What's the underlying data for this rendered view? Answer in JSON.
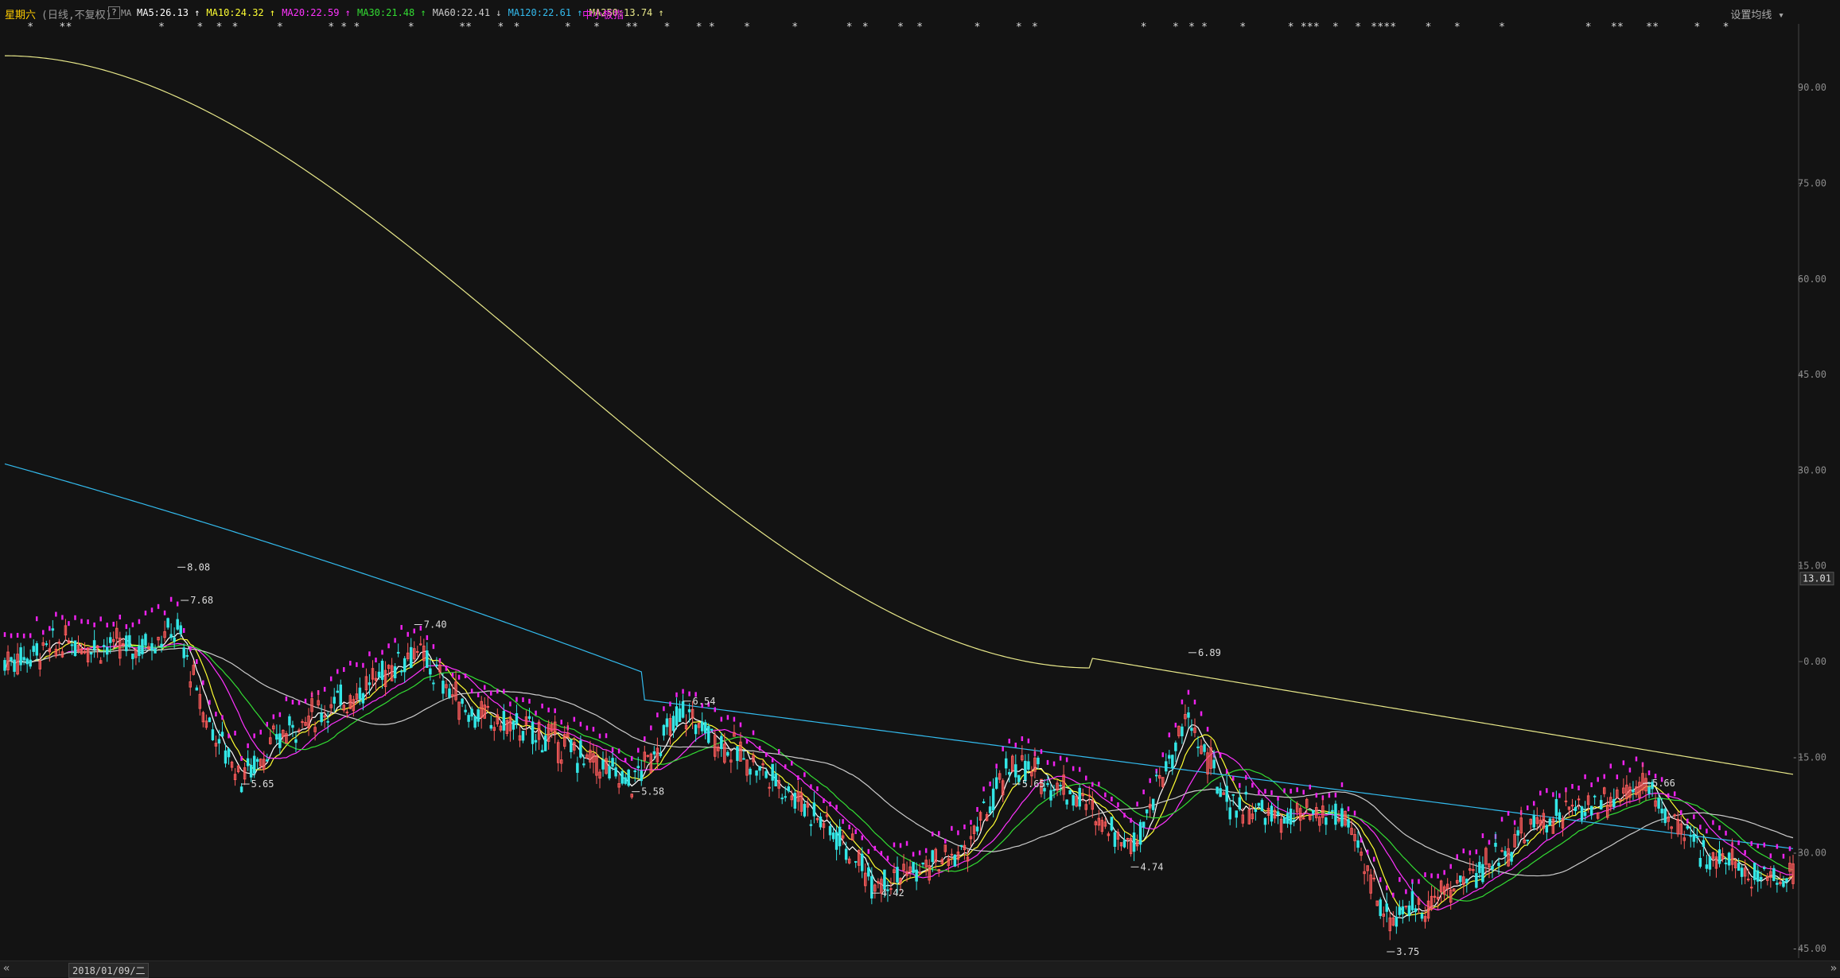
{
  "header": {
    "stock_name": "星期六",
    "mode": "(日线,不复权)",
    "help": "?",
    "ma_label": "MA",
    "ma": [
      {
        "label": "MA5:26.13",
        "arrow": "↑",
        "color": "#ffffff"
      },
      {
        "label": "MA10:24.32",
        "arrow": "↑",
        "color": "#ffff33"
      },
      {
        "label": "MA20:22.59",
        "arrow": "↑",
        "color": "#ff33ff"
      },
      {
        "label": "MA30:21.48",
        "arrow": "↑",
        "color": "#33dd33"
      },
      {
        "label": "MA60:22.41",
        "arrow": "↓",
        "color": "#cccccc"
      },
      {
        "label": "MA120:22.61",
        "arrow": "↑",
        "color": "#33bbee"
      },
      {
        "label": "MA250:13.74",
        "arrow": "↑",
        "color": "#e8e88a"
      }
    ],
    "index_label": "中小板指",
    "settings": "设置均线"
  },
  "colors": {
    "up": "#ff5c5c",
    "down": "#33e6e6",
    "index": "#ee22ee",
    "axis": "#8a8a8a",
    "ma5": "#ffffff",
    "ma10": "#ffff33",
    "ma20": "#ff33ff",
    "ma30": "#33dd33",
    "ma60": "#cccccc",
    "ma120": "#33bbee",
    "ma250": "#e8e88a"
  },
  "chart_data": {
    "type": "candlestick",
    "y_ticks": [
      "90.00",
      "75.00",
      "60.00",
      "45.00",
      "30.00",
      "15.00",
      "0.00",
      "-15.00",
      "-30.00",
      "-45.00"
    ],
    "y_tick_values": [
      90,
      75,
      60,
      45,
      30,
      15,
      0,
      -15,
      -30,
      -45
    ],
    "ylim": [
      -46.5,
      100
    ],
    "current_value_badge": "13.01",
    "current_value": 13.01,
    "annotations": [
      {
        "text": "8.08",
        "index": 54,
        "value": 14.8,
        "side": "right"
      },
      {
        "text": "7.68",
        "index": 55,
        "value": 9.6,
        "side": "right"
      },
      {
        "text": "5.65",
        "index": 74,
        "value": -19.2,
        "side": "right"
      },
      {
        "text": "7.40",
        "index": 128,
        "value": 5.8,
        "side": "right"
      },
      {
        "text": "5.58",
        "index": 196,
        "value": -20.4,
        "side": "right"
      },
      {
        "text": "6.54",
        "index": 212,
        "value": -6.2,
        "side": "right"
      },
      {
        "text": "4.42",
        "index": 271,
        "value": -36.3,
        "side": "right"
      },
      {
        "text": "5.65",
        "index": 315,
        "value": -19.2,
        "side": "right"
      },
      {
        "text": "4.74",
        "index": 352,
        "value": -32.2,
        "side": "right"
      },
      {
        "text": "6.89",
        "index": 370,
        "value": 1.4,
        "side": "right"
      },
      {
        "text": "3.75",
        "index": 432,
        "value": -45.5,
        "side": "right"
      },
      {
        "text": "5.66",
        "index": 512,
        "value": -19.1,
        "side": "right"
      }
    ],
    "markers": [
      8,
      18,
      20,
      49,
      61,
      67,
      72,
      86,
      102,
      106,
      110,
      127,
      143,
      145,
      155,
      160,
      176,
      185,
      195,
      197,
      207,
      217,
      221,
      232,
      247,
      264,
      269,
      280,
      286,
      304,
      317,
      322,
      356,
      366,
      371,
      375,
      387,
      402,
      406,
      408,
      410,
      416,
      423,
      428,
      430,
      432,
      434,
      445,
      454,
      468,
      495,
      503,
      505,
      514,
      516,
      529,
      538
    ],
    "date": "2018/01/09/二"
  }
}
